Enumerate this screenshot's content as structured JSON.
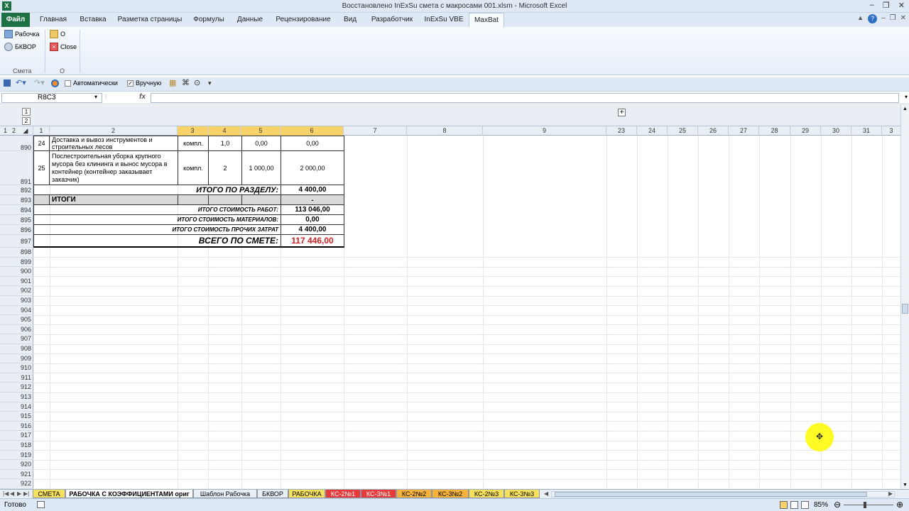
{
  "window": {
    "title": "Восстановлено InExSu смета с макросами 001.xlsm  -  Microsoft Excel"
  },
  "ribbon_tabs": [
    "Файл",
    "Главная",
    "Вставка",
    "Разметка страницы",
    "Формулы",
    "Данные",
    "Рецензирование",
    "Вид",
    "Разработчик",
    "InExSu VBE",
    "MaxBat"
  ],
  "ribbon": {
    "items": [
      "Рабочка",
      "БКВОР",
      "O",
      "Close"
    ],
    "groups": [
      "Смета",
      "O"
    ]
  },
  "qat": {
    "auto_label": "Автоматически",
    "manual_label": "Вручную"
  },
  "formula_bar": {
    "name_box": "R8C3",
    "fx": "fx",
    "formula": ""
  },
  "outline": {
    "levels": [
      "1",
      "2"
    ],
    "row_levels": [
      "1",
      "2"
    ],
    "expand": "+"
  },
  "columns": [
    "1",
    "2",
    "3",
    "4",
    "5",
    "6",
    "7",
    "8",
    "9",
    "23",
    "24",
    "25",
    "26",
    "27",
    "28",
    "29",
    "30",
    "31",
    "3"
  ],
  "rows": [
    "890",
    "891",
    "892",
    "893",
    "894",
    "895",
    "896",
    "897",
    "898",
    "899",
    "900",
    "901",
    "902",
    "903",
    "904",
    "905",
    "906",
    "907",
    "908",
    "909",
    "910",
    "911",
    "912",
    "913",
    "914",
    "915",
    "916",
    "917",
    "918",
    "919",
    "920",
    "921",
    "922"
  ],
  "table": {
    "r890": {
      "num": "24",
      "name": "Доставка и вывоз инструментов и строительных лесов",
      "unit": "компл.",
      "qty": "1,0",
      "price": "0,00",
      "total": "0,00"
    },
    "r891": {
      "num": "25",
      "name": "Послестроительная уборка крупного мусора без клининга и вынос мусора в контейнер (контейнер заказывает заказчик)",
      "unit": "компл.",
      "qty": "2",
      "price": "1 000,00",
      "total": "2 000,00"
    },
    "r892": {
      "label": "ИТОГО ПО РАЗДЕЛУ:",
      "value": "4 400,00"
    },
    "r893": {
      "label": "ИТОГИ",
      "value": "-"
    },
    "r894": {
      "label": "ИТОГО СТОИМОСТЬ РАБОТ:",
      "value": "113 046,00"
    },
    "r895": {
      "label": "ИТОГО СТОИМОСТЬ МАТЕРИАЛОВ:",
      "value": "0,00"
    },
    "r896": {
      "label": "ИТОГО СТОИМОСТЬ ПРОЧИХ ЗАТРАТ",
      "value": "4 400,00"
    },
    "r897": {
      "label": "ВСЕГО ПО СМЕТЕ:",
      "value": "117 446,00"
    }
  },
  "sheet_tabs": [
    {
      "name": "СМЕТА",
      "color": "#f6e05e"
    },
    {
      "name": "РАБОЧКА С КОЭФФИЦИЕНТАМИ  ориг",
      "color": "#ffffff"
    },
    {
      "name": "Шаблон Рабочка",
      "color": "#e9eef5"
    },
    {
      "name": "БКВОР",
      "color": "#e9eef5"
    },
    {
      "name": "РАБОЧКА",
      "color": "#f6e05e"
    },
    {
      "name": "КС-2№1",
      "color": "#e53b3b"
    },
    {
      "name": "КС-3№1",
      "color": "#e53b3b"
    },
    {
      "name": "КС-2№2",
      "color": "#f6b23a"
    },
    {
      "name": "КС-3№2",
      "color": "#f6b23a"
    },
    {
      "name": "КС-2№3",
      "color": "#f6e05e"
    },
    {
      "name": "КС-3№3",
      "color": "#f6e05e"
    }
  ],
  "status": {
    "ready": "Готово",
    "zoom": "85%"
  },
  "colors": {
    "accent": "#1e7145",
    "selected_col": "#f9d36a",
    "total_red": "#d42020"
  }
}
